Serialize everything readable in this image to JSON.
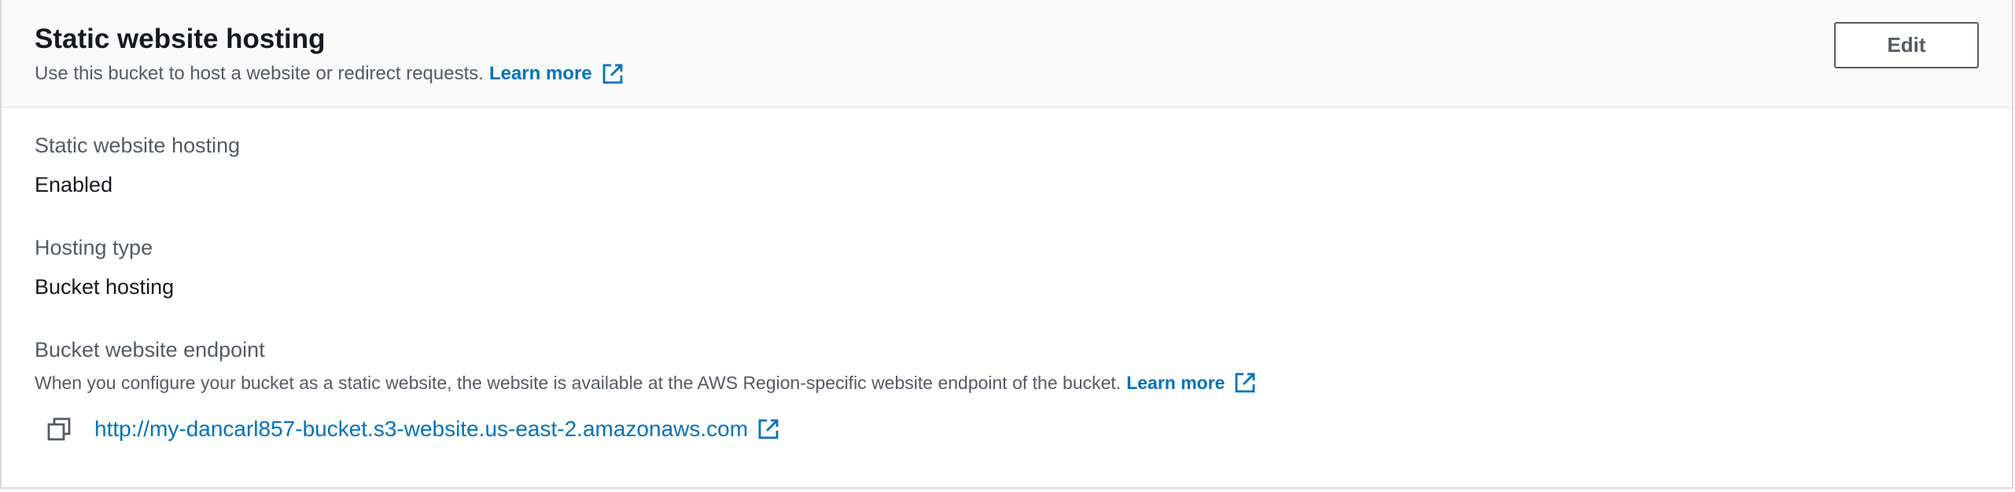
{
  "header": {
    "title": "Static website hosting",
    "description": "Use this bucket to host a website or redirect requests.",
    "learn_more": "Learn more",
    "edit_label": "Edit"
  },
  "fields": {
    "hosting_label": "Static website hosting",
    "hosting_value": "Enabled",
    "type_label": "Hosting type",
    "type_value": "Bucket hosting",
    "endpoint_label": "Bucket website endpoint",
    "endpoint_description": "When you configure your bucket as a static website, the website is available at the AWS Region-specific website endpoint of the bucket.",
    "endpoint_learn_more": "Learn more",
    "endpoint_url": "http://my-dancarl857-bucket.s3-website.us-east-2.amazonaws.com"
  },
  "icons": {
    "external": "external-link-icon",
    "copy": "copy-icon"
  },
  "colors": {
    "link": "#0073bb",
    "header_bg": "#fafafa",
    "muted_text": "#545b64",
    "text": "#16191f"
  }
}
